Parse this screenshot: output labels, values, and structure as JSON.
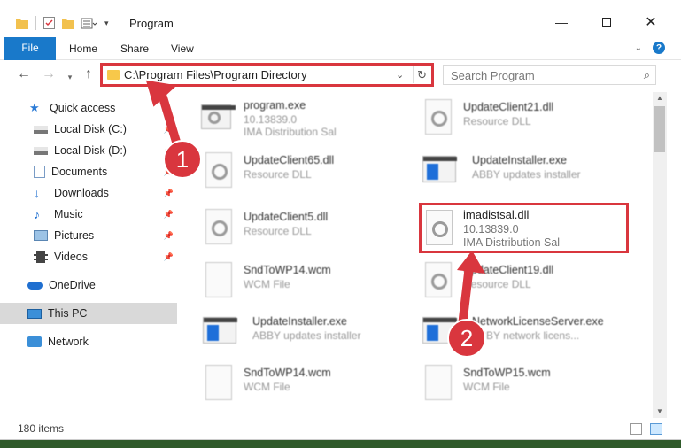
{
  "window": {
    "title": "Program",
    "controls": [
      "minimize",
      "maximize",
      "close"
    ]
  },
  "ribbon": {
    "tabs": [
      "File",
      "Home",
      "Share",
      "View"
    ]
  },
  "navigation": {
    "address_path": "C:\\Program Files\\Program Directory",
    "search_placeholder": "Search Program"
  },
  "sidebar": {
    "items": [
      {
        "label": "Quick access",
        "icon": "star-icon",
        "pinned": false
      },
      {
        "label": "Local Disk (C:)",
        "icon": "drive-icon",
        "pinned": true
      },
      {
        "label": "Local Disk (D:)",
        "icon": "drive-icon",
        "pinned": true
      },
      {
        "label": "Documents",
        "icon": "documents-icon",
        "pinned": true
      },
      {
        "label": "Downloads",
        "icon": "download-icon",
        "pinned": true
      },
      {
        "label": "Music",
        "icon": "music-icon",
        "pinned": true
      },
      {
        "label": "Pictures",
        "icon": "pictures-icon",
        "pinned": true
      },
      {
        "label": "Videos",
        "icon": "videos-icon",
        "pinned": true
      },
      {
        "label": "OneDrive",
        "icon": "cloud-icon",
        "pinned": false
      },
      {
        "label": "This PC",
        "icon": "computer-icon",
        "pinned": false,
        "selected": true
      },
      {
        "label": "Network",
        "icon": "network-icon",
        "pinned": false
      }
    ]
  },
  "files": [
    {
      "name": "program.exe",
      "line2": "10.13839.0",
      "line3": "IMA Distribution Sal",
      "type": "exe-gear"
    },
    {
      "name": "UpdateClient21.dll",
      "line2": "Resource DLL",
      "type": "dll"
    },
    {
      "name": "UpdateClient65.dll",
      "line2": "Resource DLL",
      "type": "dll"
    },
    {
      "name": "UpdateInstaller.exe",
      "line2": "ABBY updates installer",
      "type": "exe"
    },
    {
      "name": "UpdateClient5.dll",
      "line2": "Resource DLL",
      "type": "dll"
    },
    {
      "name": "imadistsal.dll",
      "line2": "10.13839.0",
      "line3": "IMA Distribution Sal",
      "type": "dll",
      "highlighted": true
    },
    {
      "name": "SndToWP14.wcm",
      "line2": "WCM File",
      "type": "doc"
    },
    {
      "name": "UpdateClient19.dll",
      "line2": "Resource DLL",
      "type": "dll"
    },
    {
      "name": "UpdateInstaller.exe",
      "line2": "ABBY updates installer",
      "type": "exe"
    },
    {
      "name": "NetworkLicenseServer.exe",
      "line2": "ABBY network licens...",
      "type": "exe"
    },
    {
      "name": "SndToWP14.wcm",
      "line2": "WCM File",
      "type": "doc"
    },
    {
      "name": "SndToWP15.wcm",
      "line2": "WCM File",
      "type": "doc"
    }
  ],
  "status": {
    "item_count": "180 items"
  },
  "callouts": {
    "step1": "1",
    "step2": "2",
    "color": "#d9363e"
  },
  "colors": {
    "accent": "#1979ca",
    "highlight": "#d9363e"
  }
}
